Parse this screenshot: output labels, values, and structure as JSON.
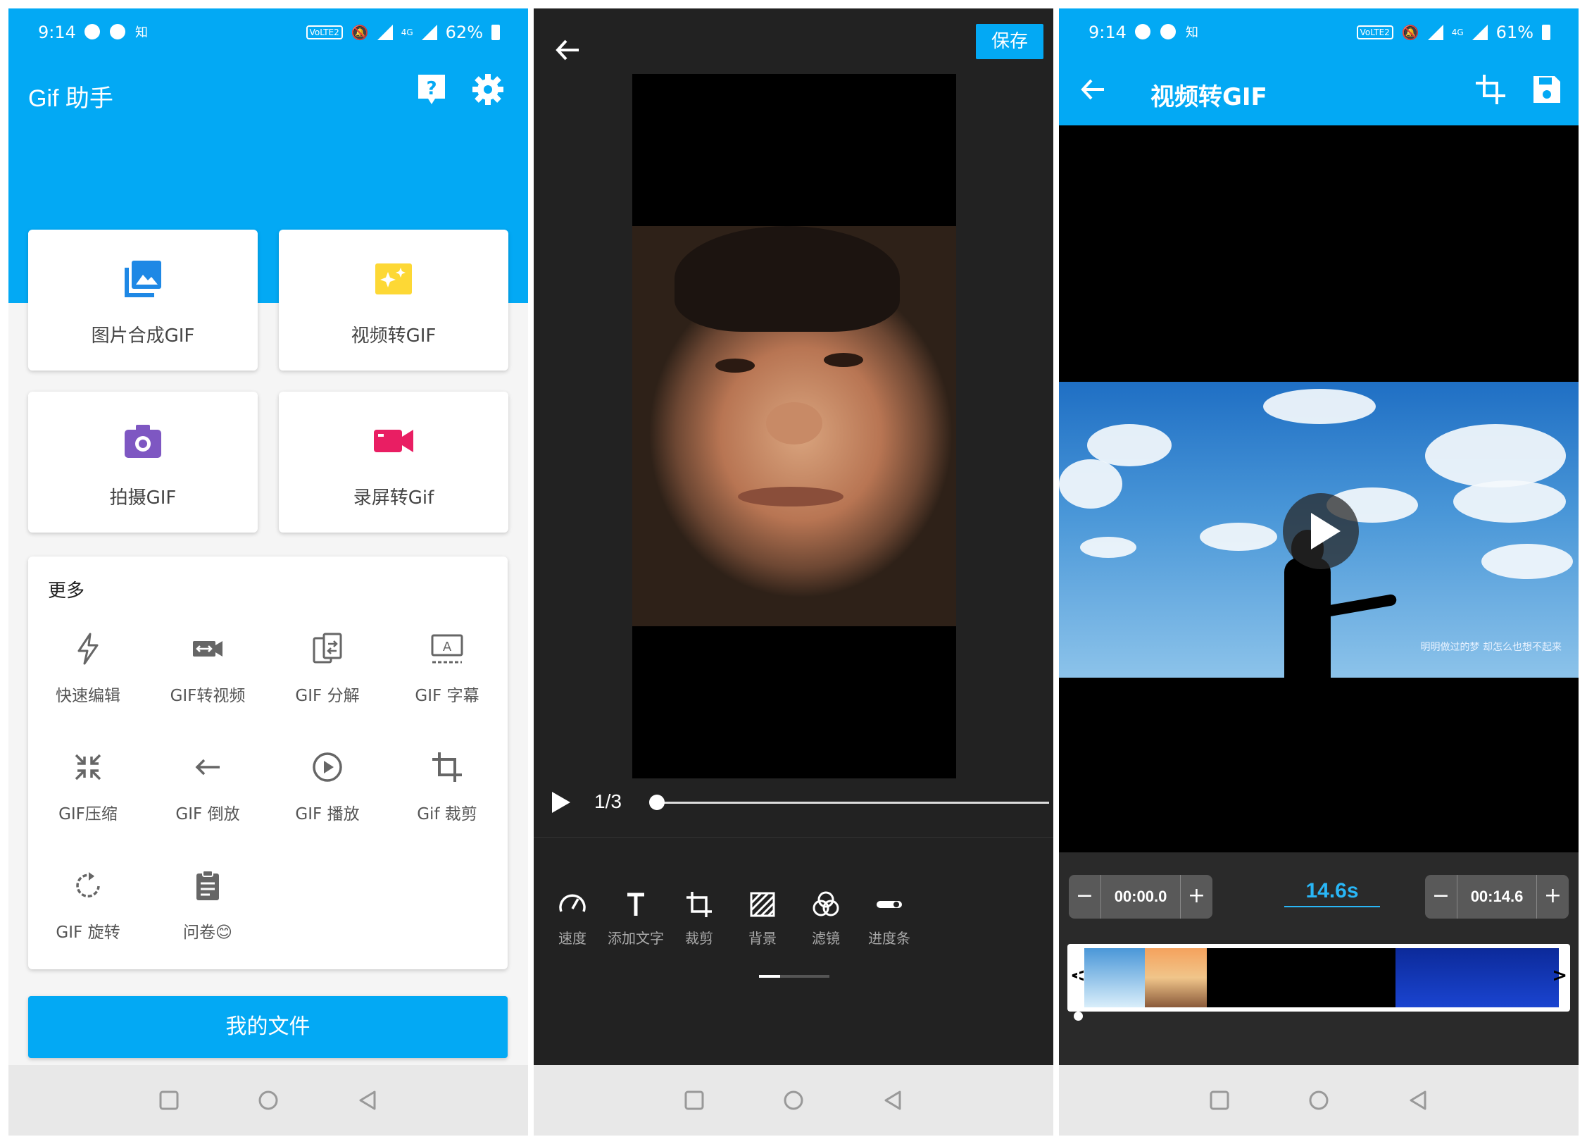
{
  "status_left": {
    "time": "9:14",
    "app": "知",
    "volte": "VoLTE2",
    "net": "4G",
    "battery": "62%"
  },
  "status_right": {
    "time": "9:14",
    "app": "知",
    "volte": "VoLTE2",
    "net": "4G",
    "battery": "61%"
  },
  "home": {
    "title": "Gif 助手",
    "header_icons": [
      "help-icon",
      "settings-icon"
    ],
    "tiles": [
      {
        "label": "图片合成GIF",
        "icon": "image-stack-icon",
        "color": "#1e88e5"
      },
      {
        "label": "视频转GIF",
        "icon": "clapper-sparkle-icon",
        "color": "#fdd835"
      },
      {
        "label": "拍摄GIF",
        "icon": "camera-icon",
        "color": "#7e57c2"
      },
      {
        "label": "录屏转Gif",
        "icon": "video-camera-icon",
        "color": "#e91e63"
      }
    ],
    "more_title": "更多",
    "tools": [
      {
        "label": "快速编辑",
        "icon": "lightning-icon"
      },
      {
        "label": "GIF转视频",
        "icon": "gif-to-video-icon"
      },
      {
        "label": "GIF 分解",
        "icon": "split-icon"
      },
      {
        "label": "GIF 字幕",
        "icon": "subtitle-icon"
      },
      {
        "label": "GIF压缩",
        "icon": "compress-icon"
      },
      {
        "label": "GIF 倒放",
        "icon": "reverse-arrow-icon"
      },
      {
        "label": "GIF 播放",
        "icon": "play-circle-icon"
      },
      {
        "label": "Gif 裁剪",
        "icon": "crop-icon"
      },
      {
        "label": "GIF 旋转",
        "icon": "rotate-icon"
      },
      {
        "label": "问卷😊",
        "icon": "clipboard-icon"
      }
    ],
    "my_files": "我的文件"
  },
  "editor": {
    "save": "保存",
    "frame_counter": "1/3",
    "progress_fraction": 0.0,
    "tools": [
      {
        "label": "速度",
        "icon": "speedometer-icon"
      },
      {
        "label": "添加文字",
        "icon": "text-icon"
      },
      {
        "label": "裁剪",
        "icon": "crop-icon"
      },
      {
        "label": "背景",
        "icon": "background-pattern-icon"
      },
      {
        "label": "滤镜",
        "icon": "filter-icon"
      },
      {
        "label": "进度条",
        "icon": "progress-toggle-icon"
      }
    ]
  },
  "video_to_gif": {
    "title": "视频转GIF",
    "header_icons": [
      "crop-icon",
      "save-icon"
    ],
    "caption": "明明做过的梦 却怎么也想不起来",
    "start_time": "00:00.0",
    "end_time": "00:14.6",
    "duration": "14.6s",
    "minus": "−",
    "plus": "+",
    "timeline_left": "<",
    "timeline_right": ">"
  },
  "colors": {
    "primary": "#03a9f4",
    "editor_bg": "#222222"
  }
}
